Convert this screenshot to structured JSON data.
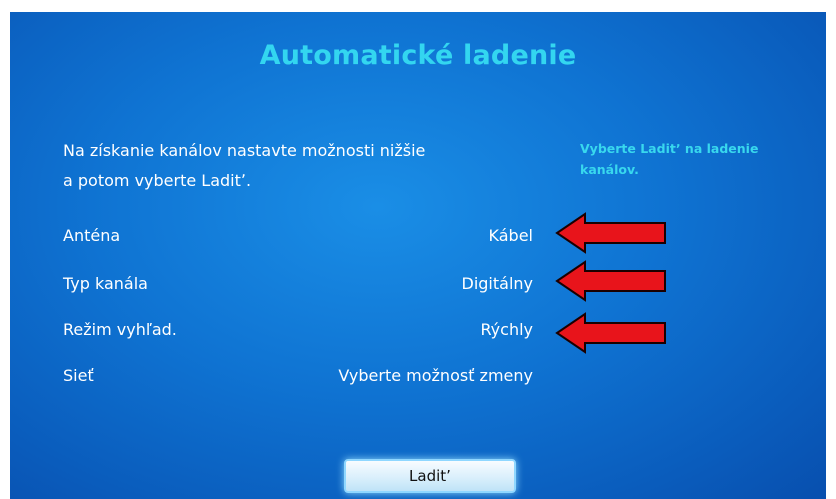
{
  "screen": {
    "title": "Automatické ladenie",
    "instruction_line1": "Na získanie kanálov nastavte možnosti nižšie",
    "instruction_line2": "a potom vyberte Laditʼ.",
    "help_line1": "Vyberte Laditʼ na ladenie",
    "help_line2": "kanálov."
  },
  "settings": [
    {
      "label": "Anténa",
      "value": "Kábel"
    },
    {
      "label": "Typ kanála",
      "value": "Digitálny"
    },
    {
      "label": "Režim vyhľad.",
      "value": "Rýchly"
    },
    {
      "label": "Sieť",
      "value": "Vyberte možnosť zmeny"
    }
  ],
  "tune_button": {
    "label": "Laditʼ"
  },
  "colors": {
    "background": "#0f73d2",
    "title": "#33d6f0",
    "help_text": "#38d8ee",
    "arrow": "#e8141b"
  }
}
